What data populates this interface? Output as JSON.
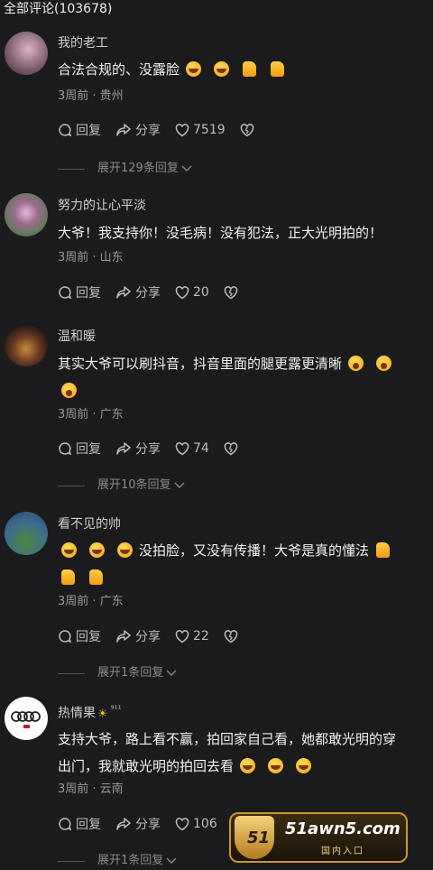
{
  "header": {
    "title": "全部评论(103678)"
  },
  "labels": {
    "reply": "回复",
    "share": "分享"
  },
  "comments": [
    {
      "username": "我的老工",
      "text": "合法合规的、没露脸",
      "meta": "3周前 · 贵州",
      "likes": "7519",
      "expand": "展开129条回复"
    },
    {
      "username": "努力的让心平淡",
      "text": "大爷！我支持你！没毛病！没有犯法，正大光明拍的！",
      "meta": "3周前 · 山东",
      "likes": "20",
      "expand": ""
    },
    {
      "username": "温和暖",
      "text": "其实大爷可以刷抖音，抖音里面的腿更露更清晰",
      "meta": "3周前 · 广东",
      "likes": "74",
      "expand": "展开10条回复"
    },
    {
      "username": "看不见的帅",
      "text": "没拍脸，又没有传播！大爷是真的懂法",
      "meta": "3周前 · 广东",
      "likes": "22",
      "expand": "展开1条回复"
    },
    {
      "username": "热情果",
      "level": "⁹¹¹",
      "text_line1": "支持大爷，路上看不赢，拍回家自己看，她都敢光明的穿",
      "text_line2": "出门，我就敢光明的拍回去看",
      "meta": "3周前 · 云南",
      "likes": "106",
      "expand": "展开1条回复"
    }
  ],
  "watermark": {
    "number": "51",
    "domain": "51awn5.com",
    "subtitle": "国内入口"
  }
}
